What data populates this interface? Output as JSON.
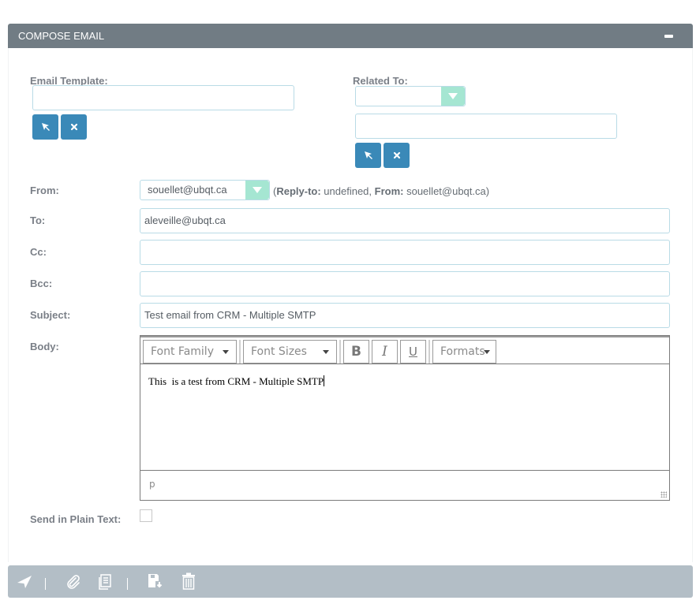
{
  "panel": {
    "title": "COMPOSE EMAIL",
    "collapse_icon": "minus-icon"
  },
  "template": {
    "label": "Email Template:",
    "value": "",
    "select_icon": "cursor-arrow-icon",
    "clear_icon": "close-icon"
  },
  "related": {
    "label": "Related To:",
    "type_value": "",
    "value": "",
    "select_icon": "cursor-arrow-icon",
    "clear_icon": "close-icon"
  },
  "from": {
    "label": "From:",
    "value": "souellet@ubqt.ca",
    "info_open": "(",
    "reply_to_label": "Reply-to:",
    "reply_to_value": " undefined, ",
    "from_label": "From:",
    "from_value": " souellet@ubqt.ca)"
  },
  "to": {
    "label": "To:",
    "value": "aleveille@ubqt.ca"
  },
  "cc": {
    "label": "Cc:",
    "value": ""
  },
  "bcc": {
    "label": "Bcc:",
    "value": ""
  },
  "subject": {
    "label": "Subject:",
    "value": "Test email from CRM - Multiple SMTP"
  },
  "body": {
    "label": "Body:",
    "toolbar": {
      "font_family": "Font Family",
      "font_sizes": "Font Sizes",
      "bold": "B",
      "italic": "I",
      "underline": "U",
      "formats": "Formats"
    },
    "content": "This  is a test from CRM - Multiple SMTP",
    "path": "p"
  },
  "plain_text": {
    "label": "Send in Plain Text:",
    "checked": false
  },
  "footer": {
    "actions": [
      "send-icon",
      "attachment-icon",
      "document-icon",
      "save-draft-icon",
      "trash-icon"
    ]
  },
  "colors": {
    "header": "#717c84",
    "button": "#3a89b8",
    "select_arrow": "#a5e6d2",
    "footer": "#b3bec6"
  }
}
